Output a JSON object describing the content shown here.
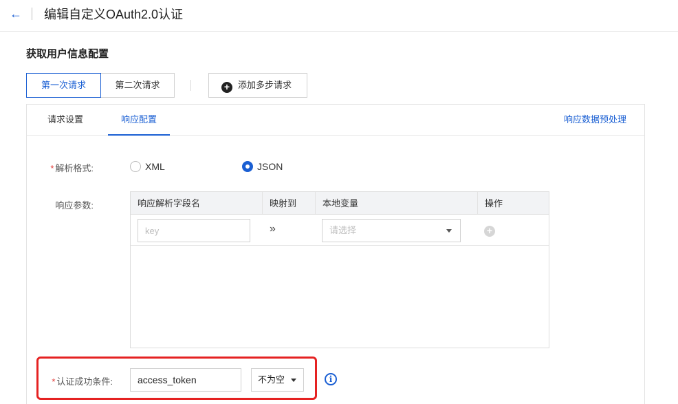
{
  "header": {
    "back_icon": "←",
    "title": "编辑自定义OAuth2.0认证"
  },
  "section": {
    "title": "获取用户信息配置"
  },
  "steps": {
    "tabs": [
      {
        "label": "第一次请求",
        "active": true
      },
      {
        "label": "第二次请求",
        "active": false
      }
    ],
    "add_label": "添加多步请求",
    "add_icon": "+"
  },
  "panel": {
    "tabs": [
      {
        "label": "请求设置",
        "active": false
      },
      {
        "label": "响应配置",
        "active": true
      }
    ],
    "preprocess_link": "响应数据预处理"
  },
  "form": {
    "required_mark": "*",
    "parse_format_label": "解析格式:",
    "parse_format_options": [
      {
        "label": "XML",
        "checked": false
      },
      {
        "label": "JSON",
        "checked": true
      }
    ],
    "response_params_label": "响应参数:",
    "table": {
      "columns": [
        "响应解析字段名",
        "映射到",
        "本地变量",
        "操作"
      ],
      "row": {
        "key_placeholder": "key",
        "map_symbol": "»",
        "var_placeholder": "请选择",
        "add_icon": "+"
      }
    },
    "success_condition_label": "认证成功条件:",
    "success_condition_value": "access_token",
    "success_condition_operator": "不为空",
    "info_icon": "i"
  },
  "colors": {
    "accent": "#1a5fd3",
    "highlight": "#e52222",
    "required": "#e23c39"
  }
}
